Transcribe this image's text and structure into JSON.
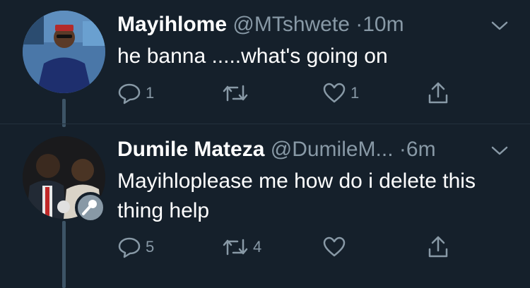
{
  "tweets": [
    {
      "name": "Mayihlome",
      "handle": "@MTshwete",
      "separator": "·",
      "time": "10m",
      "text": "he banna .....what's going on",
      "reply_count": "1",
      "retweet_count": "",
      "like_count": "1"
    },
    {
      "name": "Dumile Mateza",
      "handle": "@DumileM...",
      "separator": "·",
      "time": "6m",
      "text": "Mayihloplease me how do i delete this thing help",
      "reply_count": "5",
      "retweet_count": "4",
      "like_count": ""
    }
  ],
  "theme": {
    "background": "#15202b",
    "text": "#ffffff",
    "muted": "#8899a6",
    "thread_line": "#3d5466"
  },
  "icons": {
    "reply": "reply-icon",
    "retweet": "retweet-icon",
    "like": "heart-icon",
    "share": "share-icon",
    "caret": "chevron-down-icon",
    "badge": "microphone-icon"
  }
}
